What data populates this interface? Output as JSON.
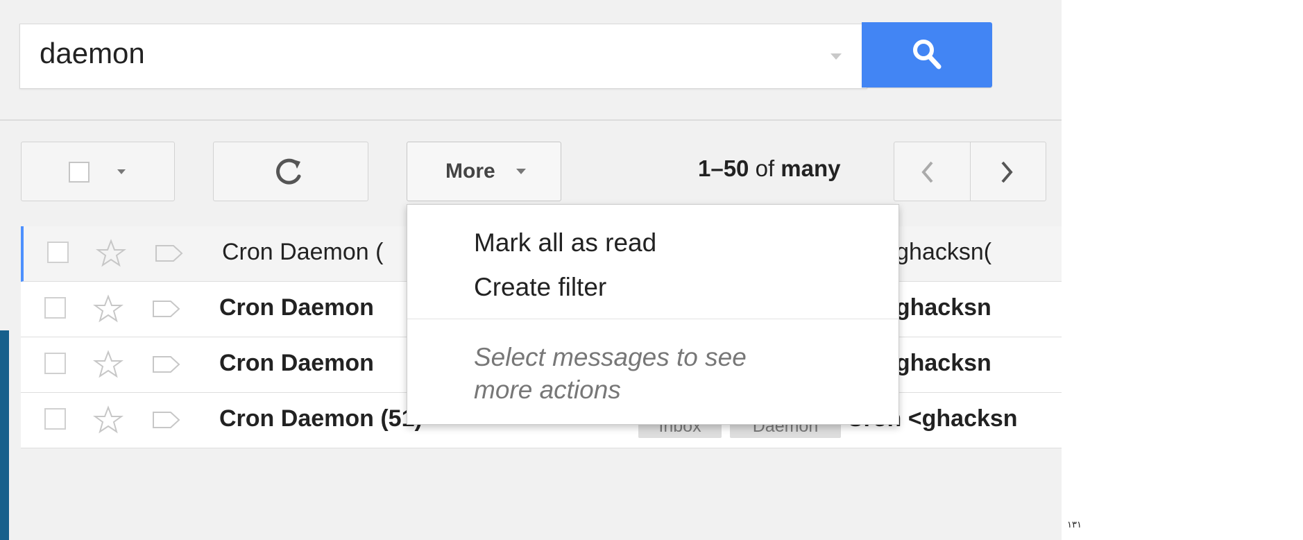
{
  "search": {
    "query": "daemon"
  },
  "toolbar": {
    "more_label": "More",
    "count_prefix": "1–50",
    "count_middle": " of ",
    "count_suffix": "many"
  },
  "dropdown": {
    "items": [
      "Mark all as read",
      "Create filter"
    ],
    "help_text": "Select messages to see more actions"
  },
  "emails": [
    {
      "sender": "Cron Daemon (",
      "subject": "on <ghacksn(",
      "unread": false
    },
    {
      "sender": "Cron Daemon",
      "subject": "on <ghacksn",
      "unread": true
    },
    {
      "sender": "Cron Daemon",
      "subject": "on <ghacksn",
      "unread": true
    },
    {
      "sender": "Cron Daemon (51)",
      "tags": [
        "Inbox",
        "Daemon"
      ],
      "subject": "Cron <ghacksn",
      "unread": true
    }
  ],
  "page_number": "١٣١",
  "colors": {
    "search_button": "#4285f4",
    "selected_row_accent": "#4d90fe",
    "left_accent": "#17608c"
  }
}
